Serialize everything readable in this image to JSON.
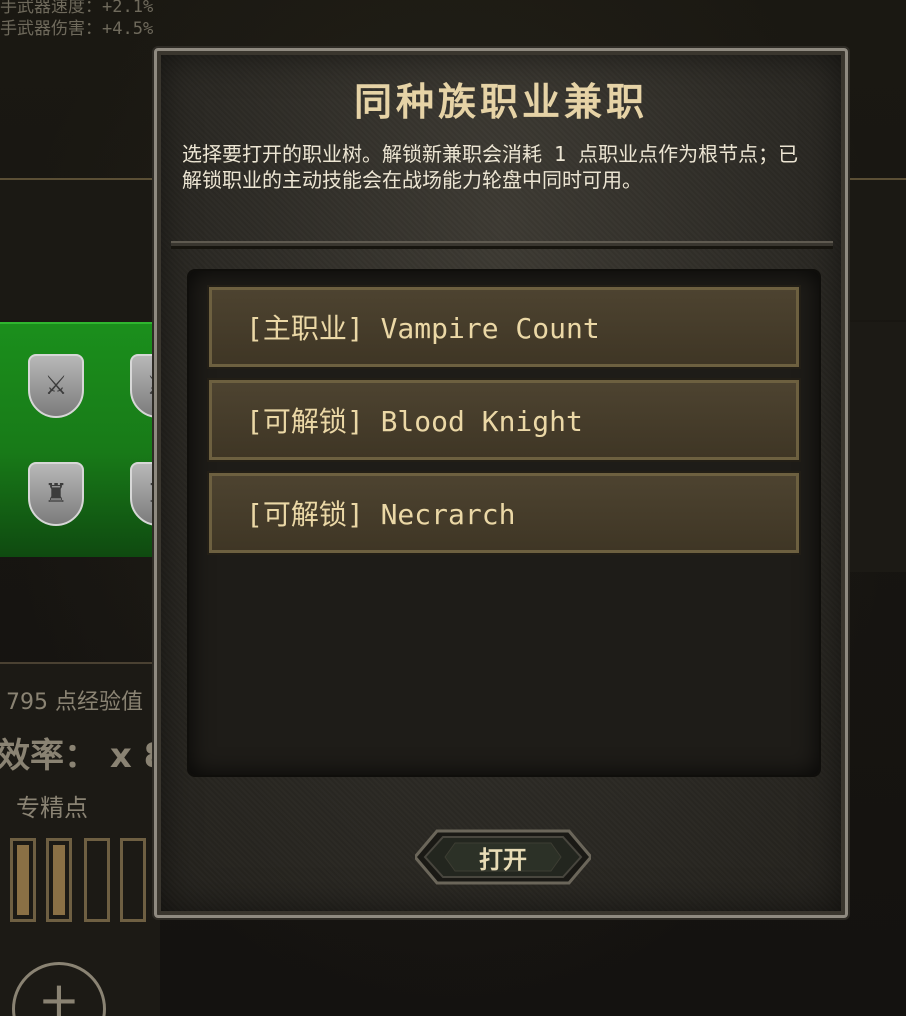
{
  "background": {
    "stats_lines": [
      "手武器速度：+2.1%",
      "手武器伤害：+4.5%"
    ],
    "experience_text": "795 点经验值",
    "rate_text": "效率： x 8",
    "spec_points_label": "专精点",
    "add_button_symbol": "+"
  },
  "dialog": {
    "title": "同种族职业兼职",
    "description": "选择要打开的职业树。解锁新兼职会消耗 1 点职业点作为根节点；已解锁职业的主动技能会在战场能力轮盘中同时可用。",
    "options": [
      {
        "label": "[主职业] Vampire Count"
      },
      {
        "label": "[可解锁] Blood Knight"
      },
      {
        "label": "[可解锁] Necrarch"
      }
    ],
    "open_button_label": "打开"
  },
  "colors": {
    "title": "#e6d3a6",
    "option_text": "#ebd8a6",
    "option_bg": "#4d4330",
    "green_panel": "#1b8f1c"
  }
}
